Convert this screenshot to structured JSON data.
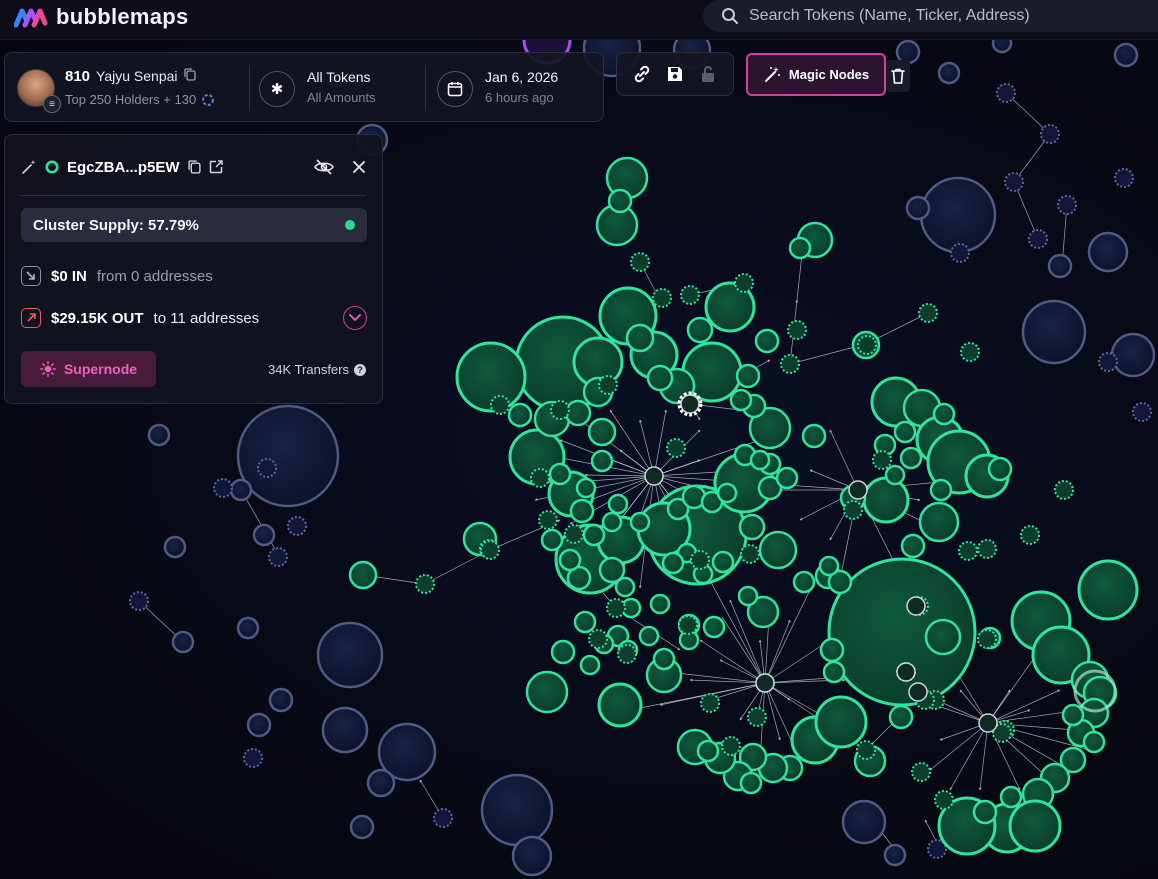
{
  "app": {
    "name": "bubblemaps"
  },
  "search": {
    "placeholder": "Search Tokens (Name, Ticker, Address)"
  },
  "header": {
    "holder_count": "810",
    "holder_name": "Yajyu Senpai",
    "holder_sub": "Top 250 Holders + 130",
    "tokens_title": "All Tokens",
    "tokens_sub": "All Amounts",
    "date_title": "Jan 6, 2026",
    "date_sub": "6 hours ago"
  },
  "toolbar": {
    "icons": [
      "link-icon",
      "save-icon",
      "lock-icon"
    ],
    "magic_label": "Magic Nodes"
  },
  "node_panel": {
    "address": "EgcZBA...p5EW",
    "cluster_label": "Cluster Supply: 57.79%",
    "in_amount": "$0 IN",
    "in_desc": "from 0 addresses",
    "out_amount": "$29.15K OUT",
    "out_desc": "to 11 addresses",
    "supernode_label": "Supernode",
    "transfers_label": "34K Transfers",
    "help_glyph": "?"
  },
  "colors": {
    "accent_pink": "#d13fa0",
    "green_node": "#2ee59d",
    "blue_node": "#4a5680",
    "background": "#070915"
  }
}
